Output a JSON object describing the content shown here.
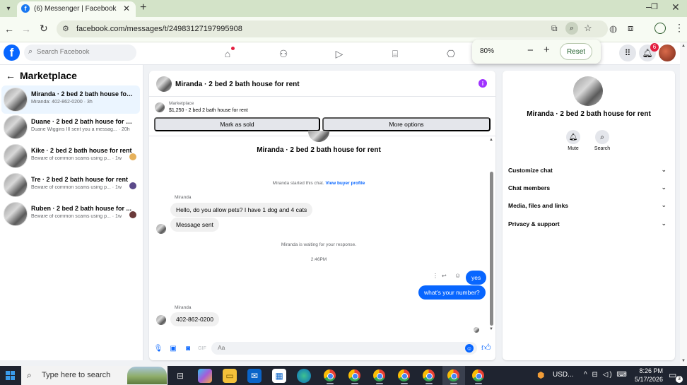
{
  "browser": {
    "tab_title": "(6) Messenger | Facebook",
    "url": "facebook.com/messages/t/24983127197995908",
    "zoom_popup": {
      "level": "80%",
      "reset_label": "Reset"
    }
  },
  "fb_header": {
    "search_placeholder": "Search Facebook",
    "notification_count": "6"
  },
  "sidebar": {
    "title": "Marketplace",
    "conversations": [
      {
        "name": "Miranda · 2 bed 2 bath house for r...",
        "sub": "Miranda: 402-862-0200 · 3h",
        "selected": true
      },
      {
        "name": "Duane · 2 bed 2 bath house for rent",
        "sub": "Duane Wiggins III sent you a messag... · 20h",
        "selected": false
      },
      {
        "name": "Kike · 2 bed 2 bath house for rent",
        "sub": "Beware of common scams using p... · 1w",
        "selected": false
      },
      {
        "name": "Tre · 2 bed 2 bath house for rent",
        "sub": "Beware of common scams using p... · 1w",
        "selected": false
      },
      {
        "name": "Ruben · 2 bed 2 bath house for ...",
        "sub": "Beware of common scams using p... · 1w",
        "selected": false
      }
    ]
  },
  "chat": {
    "header_title": "Miranda · 2 bed 2 bath house for rent",
    "marketplace_label": "Marketplace",
    "listing": "$1,250 - 2 bed 2 bath house for rent",
    "mark_sold_label": "Mark as sold",
    "more_options_label": "More options",
    "conversation_heading": "Miranda · 2 bed 2 bath house for rent",
    "started_text": "Miranda started this chat.",
    "view_profile_label": "View buyer profile",
    "sender_name_1": "Miranda",
    "msg_in_1": "Hello, do you allow pets? I have 1 dog and 4 cats",
    "msg_in_2": "Message sent",
    "waiting_text": "Miranda is waiting for your response.",
    "time_text": "2:46PM",
    "msg_out_1": "yes",
    "msg_out_2": "what's your number?",
    "sender_name_2": "Miranda",
    "msg_in_3": "402-862-0200",
    "composer_placeholder": "Aa"
  },
  "right_panel": {
    "title": "Miranda · 2 bed 2 bath house for rent",
    "mute_label": "Mute",
    "search_label": "Search",
    "sections": [
      "Customize chat",
      "Chat members",
      "Media, files and links",
      "Privacy & support"
    ]
  },
  "taskbar": {
    "search_text": "Type here to search",
    "tray_label": "USD...",
    "time": "8:26 PM",
    "date": "5/17/2026",
    "notif_count": "3"
  },
  "colors": {
    "fb_blue": "#0866ff",
    "selected_conv_bg": "#ebf5ff",
    "badge_red": "#e41e3f",
    "tab_bar": "#d3e3c8"
  }
}
